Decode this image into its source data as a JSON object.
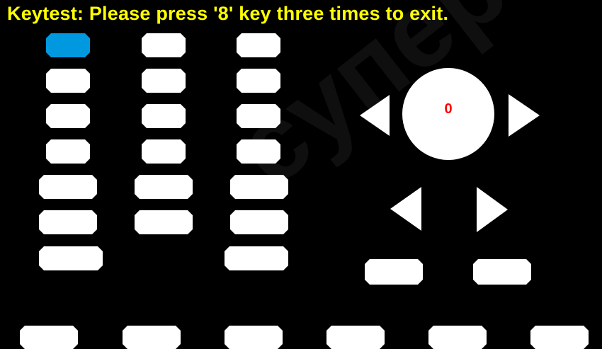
{
  "header": {
    "title": "Keytest: Please press '8' key three times to exit."
  },
  "knob": {
    "value": "0"
  },
  "watermark": {
    "text": "суперсис"
  },
  "colors": {
    "background": "#000000",
    "title": "#FFFF00",
    "key": "#FFFFFF",
    "key_active": "#0099E0",
    "knob_value": "#FF0000"
  }
}
